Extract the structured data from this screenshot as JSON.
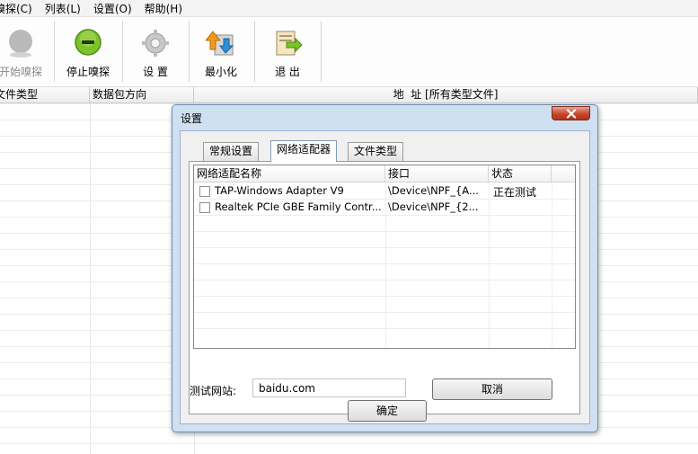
{
  "menu": [
    "嗅探(C)",
    "列表(L)",
    "设置(O)",
    "帮助(H)"
  ],
  "toolbar": {
    "start": "开始嗅探",
    "stop": "停止嗅探",
    "settings": "设 置",
    "minimize": "最小化",
    "exit": "退 出"
  },
  "list": {
    "columns": [
      "文件类型",
      "数据包方向",
      "地  址 [所有类型文件]"
    ]
  },
  "dialog": {
    "title": "设置",
    "tabs": [
      "常规设置",
      "网络适配器",
      "文件类型"
    ],
    "active_tab": "网络适配器",
    "adapter_table": {
      "columns": [
        "网络适配名称",
        "接口",
        "状态"
      ],
      "rows": [
        {
          "checked": false,
          "name": "TAP-Windows Adapter V9",
          "interface": "\\Device\\NPF_{A...",
          "status": "正在测试"
        },
        {
          "checked": false,
          "name": "Realtek PCIe GBE Family Contr...",
          "interface": "\\Device\\NPF_{2...",
          "status": ""
        }
      ]
    },
    "test_site_label": "测试网站:",
    "test_site_value": "baidu.com",
    "cancel_label": "取消",
    "ok_label": "确定"
  },
  "colors": {
    "dialog_frame": "#cfe0f2",
    "close_button": "#c6482c",
    "stop_icon": "#7cc22a"
  }
}
